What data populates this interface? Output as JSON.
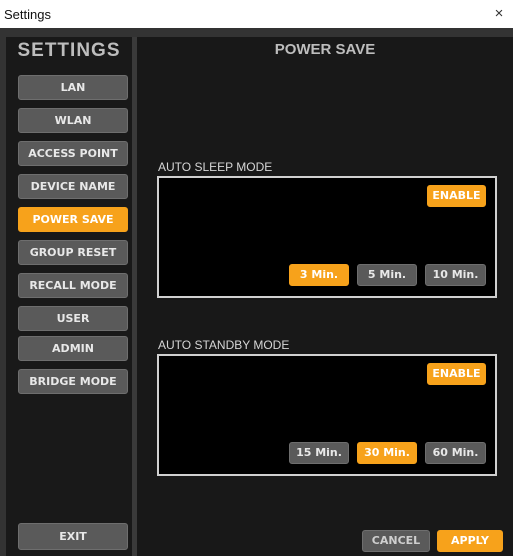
{
  "window": {
    "title": "Settings",
    "close_glyph": "×"
  },
  "colors": {
    "accent": "#f7a21b",
    "button": "#5a5a5a",
    "panel_border": "#d0d0d0",
    "background": "#181818"
  },
  "sidebar": {
    "title": "SETTINGS",
    "items": [
      {
        "label": "LAN",
        "active": false
      },
      {
        "label": "WLAN",
        "active": false
      },
      {
        "label": "ACCESS POINT",
        "active": false
      },
      {
        "label": "DEVICE NAME",
        "active": false
      },
      {
        "label": "POWER SAVE",
        "active": true
      },
      {
        "label": "GROUP RESET",
        "active": false
      },
      {
        "label": "RECALL MODE",
        "active": false
      },
      {
        "label": "USER",
        "active": false
      },
      {
        "label": "ADMIN",
        "active": false
      },
      {
        "label": "BRIDGE MODE",
        "active": false
      }
    ],
    "exit_label": "EXIT"
  },
  "main": {
    "title": "POWER SAVE",
    "auto_sleep": {
      "label": "AUTO SLEEP MODE",
      "enable_label": "ENABLE",
      "options": [
        {
          "label": "3 Min.",
          "selected": true
        },
        {
          "label": "5 Min.",
          "selected": false
        },
        {
          "label": "10 Min.",
          "selected": false
        }
      ]
    },
    "auto_standby": {
      "label": "AUTO STANDBY MODE",
      "enable_label": "ENABLE",
      "options": [
        {
          "label": "15 Min.",
          "selected": false
        },
        {
          "label": "30 Min.",
          "selected": true
        },
        {
          "label": "60 Min.",
          "selected": false
        }
      ]
    },
    "cancel_label": "CANCEL",
    "apply_label": "APPLY"
  }
}
